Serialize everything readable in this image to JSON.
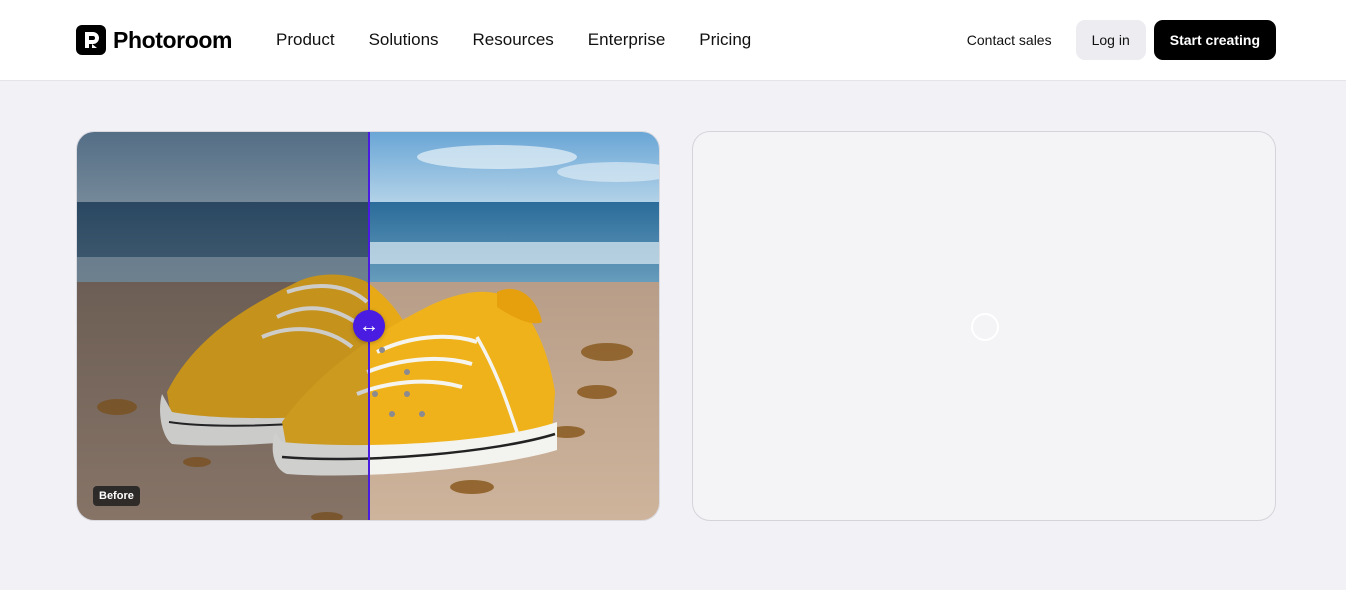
{
  "header": {
    "brand": "Photoroom",
    "nav": [
      "Product",
      "Solutions",
      "Resources",
      "Enterprise",
      "Pricing"
    ],
    "contact_label": "Contact sales",
    "login_label": "Log in",
    "start_label": "Start creating"
  },
  "compare": {
    "before_label": "Before",
    "handle_glyph": "↔",
    "accent_color": "#4a1be0"
  },
  "icons": {
    "logo": "photoroom-logo-icon",
    "handle": "horizontal-arrows-icon",
    "loading": "loading-spinner-icon"
  }
}
